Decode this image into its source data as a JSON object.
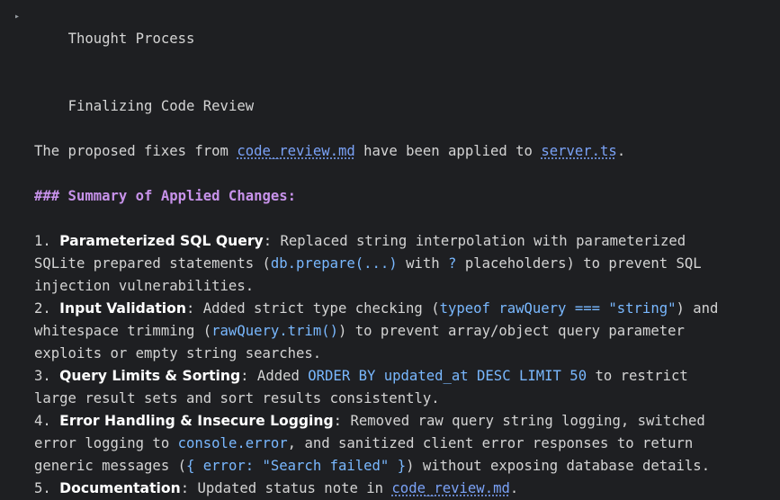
{
  "header": {
    "toggle_glyph": "▸",
    "title": "Thought Process",
    "subtitle": "Finalizing Code Review"
  },
  "intro": {
    "text1": "The proposed fixes from ",
    "link1": "code_review.md",
    "text2": " have been applied to ",
    "link2": "server.ts",
    "text3": "."
  },
  "summary_heading": "### Summary of Applied Changes:",
  "items": [
    {
      "num": "1. ",
      "title": "Parameterized SQL Query",
      "l1a": ": Replaced string interpolation with parameterized",
      "l2a": "SQLite prepared statements (",
      "l2code": "db.prepare(...)",
      "l2b": " with ",
      "l2code2": "?",
      "l2c": " placeholders) to prevent SQL",
      "l3": "injection vulnerabilities."
    },
    {
      "num": "2. ",
      "title": "Input Validation",
      "l1a": ": Added strict type checking (",
      "l1code": "typeof rawQuery === \"string\"",
      "l1b": ") and",
      "l2a": "whitespace trimming (",
      "l2code": "rawQuery.trim()",
      "l2b": ") to prevent array/object query parameter",
      "l3": "exploits or empty string searches."
    },
    {
      "num": "3. ",
      "title": "Query Limits & Sorting",
      "l1a": ": Added ",
      "l1code": "ORDER BY updated_at DESC LIMIT 50",
      "l1b": " to restrict",
      "l2a": "large result sets and sort results consistently."
    },
    {
      "num": "4. ",
      "title": "Error Handling & Insecure Logging",
      "l1a": ": Removed raw query string logging, switched",
      "l2a": "error logging to ",
      "l2code": "console.error",
      "l2b": ", and sanitized client error responses to return",
      "l3a": "generic messages (",
      "l3code": "{ error: \"Search failed\" }",
      "l3b": ") without exposing database details."
    },
    {
      "num": "5. ",
      "title": "Documentation",
      "l1a": ": Updated status note in ",
      "l1link": "code_review.md",
      "l1b": "."
    }
  ]
}
